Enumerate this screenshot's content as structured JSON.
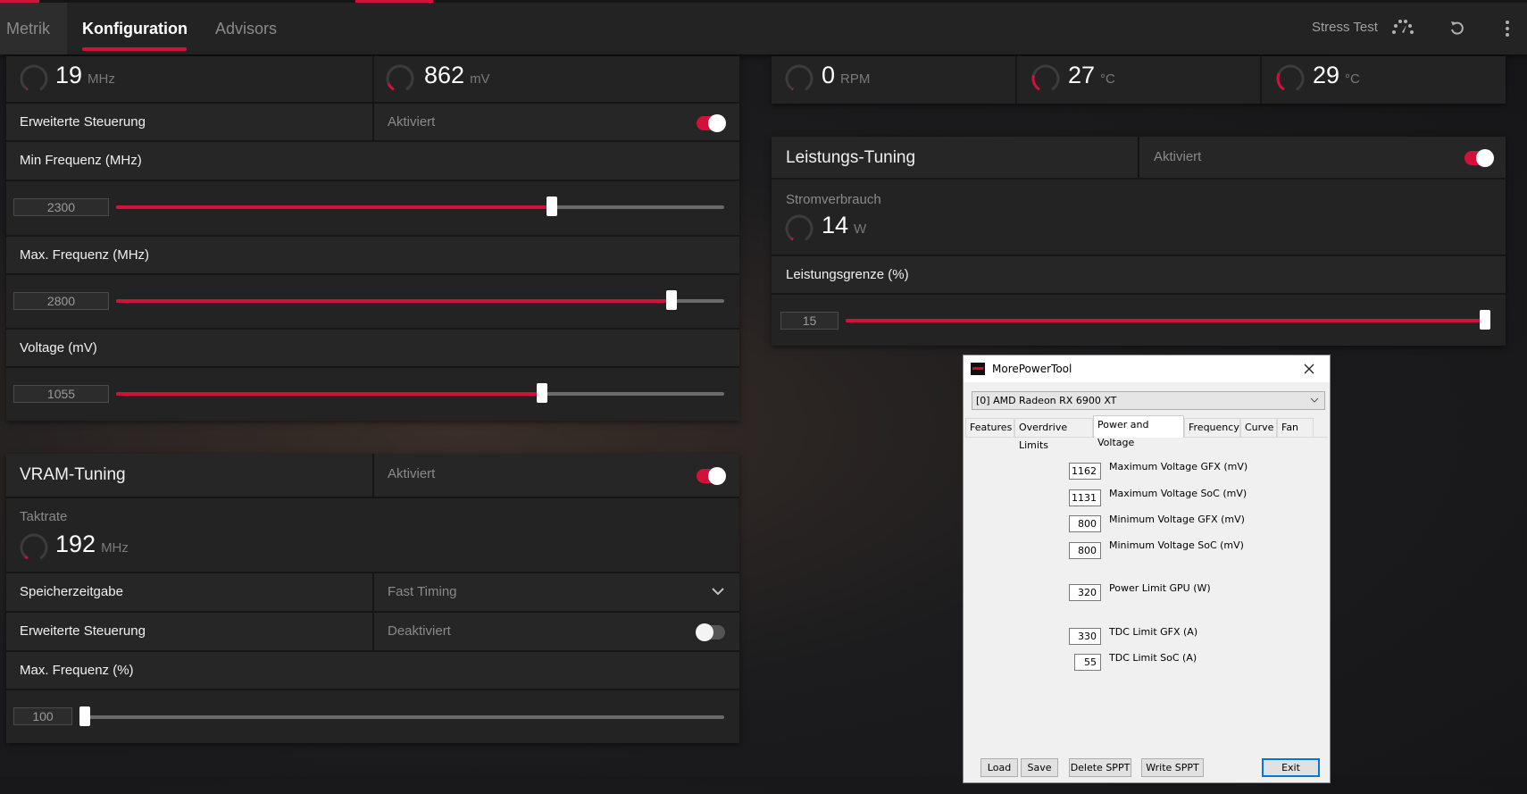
{
  "nav": {
    "tabs": [
      {
        "label": "Metrik"
      },
      {
        "label": "Konfiguration",
        "active": true
      },
      {
        "label": "Advisors"
      }
    ],
    "stress_test": "Stress Test",
    "icons": [
      "speedometer-icon",
      "reset-icon",
      "more-vertical-icon"
    ]
  },
  "colors": {
    "accent": "#d3103a",
    "panel": "#232323",
    "dialog": "#f0f0f0"
  },
  "gpu_tuning": {
    "gauges": [
      {
        "value": "19",
        "unit": "MHz",
        "level": 0.0
      },
      {
        "value": "862",
        "unit": "mV",
        "level": 0.12
      }
    ],
    "advanced": {
      "label": "Erweiterte Steuerung",
      "state": "Aktiviert",
      "on": true
    },
    "sliders": [
      {
        "label": "Min Frequenz (MHz)",
        "value": "2300",
        "fill": 0.716
      },
      {
        "label": "Max. Frequenz (MHz)",
        "value": "2800",
        "fill": 0.913
      },
      {
        "label": "Voltage (mV)",
        "value": "1055",
        "fill": 0.7
      }
    ]
  },
  "fan_temp": {
    "gauges": [
      {
        "value": "0",
        "unit": "RPM",
        "level": 0.0
      },
      {
        "value": "27",
        "unit": "°C",
        "level": 0.25
      },
      {
        "value": "29",
        "unit": "°C",
        "level": 0.28
      }
    ]
  },
  "power_tuning": {
    "title": "Leistungs-Tuning",
    "state": "Aktiviert",
    "on": true,
    "consumption_label": "Stromverbrauch",
    "consumption": {
      "value": "14",
      "unit": "W",
      "level": 0.02
    },
    "limit": {
      "label": "Leistungsgrenze (%)",
      "value": "15",
      "fill": 1.0
    }
  },
  "vram_tuning": {
    "title": "VRAM-Tuning",
    "state": "Aktiviert",
    "on": true,
    "clock_label": "Taktrate",
    "clock": {
      "value": "192",
      "unit": "MHz",
      "level": 0.05
    },
    "timing": {
      "label": "Speicherzeitgabe",
      "value": "Fast Timing"
    },
    "advanced": {
      "label": "Erweiterte Steuerung",
      "state": "Deaktiviert",
      "on": false
    },
    "max_freq": {
      "label": "Max. Frequenz (%)",
      "value": "100",
      "fill": 0.0
    }
  },
  "dialog": {
    "title": "MorePowerTool",
    "device": "[0] AMD Radeon RX 6900 XT",
    "tabs": [
      "Features",
      "Overdrive Limits",
      "Power and Voltage",
      "Frequency",
      "Curve",
      "Fan"
    ],
    "active_tab": "Power and Voltage",
    "fields": [
      {
        "value": "1162",
        "label": "Maximum Voltage GFX (mV)"
      },
      {
        "value": "1131",
        "label": "Maximum Voltage SoC (mV)"
      },
      {
        "value": "800",
        "label": "Minimum Voltage GFX (mV)"
      },
      {
        "value": "800",
        "label": "Minimum Voltage SoC (mV)"
      },
      {
        "value": "320",
        "label": "Power Limit GPU (W)"
      },
      {
        "value": "330",
        "label": "TDC Limit GFX (A)"
      },
      {
        "value": "55",
        "label": "TDC Limit SoC (A)"
      }
    ],
    "buttons": [
      "Load",
      "Save",
      "Delete SPPT",
      "Write SPPT",
      "Exit"
    ]
  }
}
